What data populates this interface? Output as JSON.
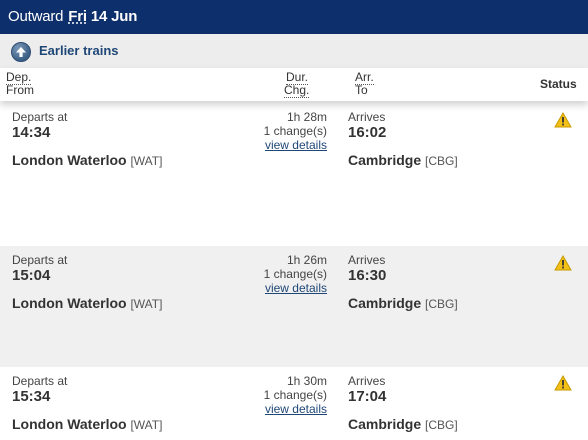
{
  "header": {
    "outward_label": "Outward",
    "day": "Fri",
    "date": "14 Jun"
  },
  "earlier": {
    "label": "Earlier trains",
    "icon": "arrow-up-circle-icon"
  },
  "columns": {
    "dep": "Dep.",
    "from": "From",
    "dur": "Dur.",
    "chg": "Chg.",
    "arr": "Arr.",
    "to": "To",
    "status": "Status"
  },
  "journeys": [
    {
      "departs_label": "Departs at",
      "dep_time": "14:34",
      "from_station": "London Waterloo",
      "from_code": "[WAT]",
      "duration": "1h 28m",
      "changes": "1 change(s)",
      "details_link": "view details",
      "arrives_label": "Arrives",
      "arr_time": "16:02",
      "to_station": "Cambridge",
      "to_code": "[CBG]",
      "status_icon": "warning-icon"
    },
    {
      "departs_label": "Departs at",
      "dep_time": "15:04",
      "from_station": "London Waterloo",
      "from_code": "[WAT]",
      "duration": "1h 26m",
      "changes": "1 change(s)",
      "details_link": "view details",
      "arrives_label": "Arrives",
      "arr_time": "16:30",
      "to_station": "Cambridge",
      "to_code": "[CBG]",
      "status_icon": "warning-icon"
    },
    {
      "departs_label": "Departs at",
      "dep_time": "15:34",
      "from_station": "London Waterloo",
      "from_code": "[WAT]",
      "duration": "1h 30m",
      "changes": "1 change(s)",
      "details_link": "view details",
      "arrives_label": "Arrives",
      "arr_time": "17:04",
      "to_station": "Cambridge",
      "to_code": "[CBG]",
      "status_icon": "warning-icon"
    }
  ],
  "colors": {
    "header_bg": "#0d2f6b",
    "link": "#1f4776",
    "warning": "#f3c017"
  }
}
